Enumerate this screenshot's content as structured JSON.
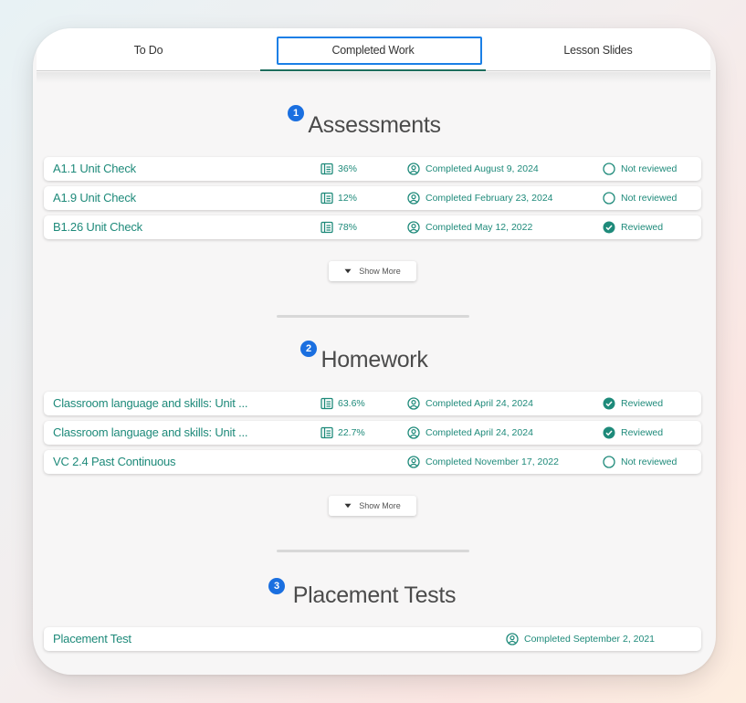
{
  "tabs": [
    {
      "label": "To Do"
    },
    {
      "label": "Completed Work"
    },
    {
      "label": "Lesson Slides"
    }
  ],
  "colors": {
    "accent": "#1e8a7a",
    "focus": "#1a7fe6",
    "badge": "#1a6fe0",
    "tab_underline": "#1e6e5e"
  },
  "sections": {
    "assessments": {
      "badge": "1",
      "title": "Assessments",
      "show_more": "Show More",
      "rows": [
        {
          "name": "A1.1 Unit Check",
          "score": "36%",
          "completed": "Completed August 9, 2024",
          "status": "Not reviewed",
          "reviewed": false
        },
        {
          "name": "A1.9 Unit Check",
          "score": "12%",
          "completed": "Completed February 23, 2024",
          "status": "Not reviewed",
          "reviewed": false
        },
        {
          "name": "B1.26 Unit Check",
          "score": "78%",
          "completed": "Completed May 12, 2022",
          "status": "Reviewed",
          "reviewed": true
        }
      ]
    },
    "homework": {
      "badge": "2",
      "title": "Homework",
      "show_more": "Show More",
      "rows": [
        {
          "name": "Classroom language and skills: Unit ...",
          "score": "63.6%",
          "completed": "Completed April 24, 2024",
          "status": "Reviewed",
          "reviewed": true
        },
        {
          "name": "Classroom language and skills: Unit ...",
          "score": "22.7%",
          "completed": "Completed April 24, 2024",
          "status": "Reviewed",
          "reviewed": true
        },
        {
          "name": "VC 2.4 Past Continuous",
          "score": "",
          "completed": "Completed November 17, 2022",
          "status": "Not reviewed",
          "reviewed": false
        }
      ]
    },
    "placement": {
      "badge": "3",
      "title": "Placement Tests",
      "rows": [
        {
          "name": "Placement Test",
          "completed": "Completed September 2, 2021"
        }
      ]
    }
  }
}
